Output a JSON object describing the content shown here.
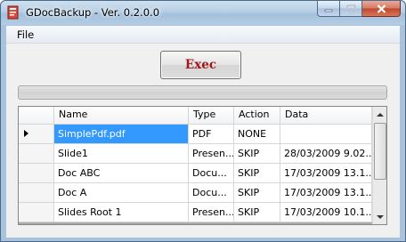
{
  "window": {
    "title": "GDocBackup - Ver. 0.2.0.0",
    "icon": "gdocbackup-app-icon",
    "caption_buttons": [
      "minimize-icon",
      "maximize-icon",
      "close-icon"
    ]
  },
  "menu": {
    "items": [
      {
        "label": "File"
      }
    ]
  },
  "toolbar": {
    "exec_label": "Exec"
  },
  "progress": {
    "value_percent": 0
  },
  "grid": {
    "columns": [
      "Name",
      "Type",
      "Action",
      "Data"
    ],
    "selected_row": 0,
    "rows": [
      {
        "name": "SimplePdf.pdf",
        "type": "PDF",
        "action": "NONE",
        "data": ""
      },
      {
        "name": "Slide1",
        "type": "Presen...",
        "action": "SKIP",
        "data": "28/03/2009 9.02..."
      },
      {
        "name": "Doc ABC",
        "type": "Docu...",
        "action": "SKIP",
        "data": "17/03/2009 13.1..."
      },
      {
        "name": "Doc A",
        "type": "Docu...",
        "action": "SKIP",
        "data": "17/03/2009 13.1..."
      },
      {
        "name": "Slides Root 1",
        "type": "Presen...",
        "action": "SKIP",
        "data": "17/03/2009 10.1..."
      }
    ]
  },
  "colors": {
    "exec_text": "#a01818",
    "selection": "#3399ff",
    "titlebar": "#b7cfe6"
  }
}
